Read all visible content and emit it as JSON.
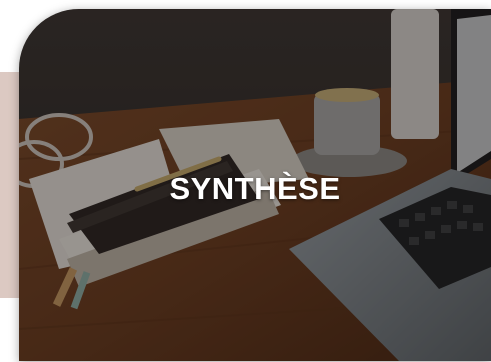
{
  "tile": {
    "title": "SYNTHÈSE",
    "accent_color": "#dcc9c2",
    "overlay_color": "#0f0a08"
  }
}
